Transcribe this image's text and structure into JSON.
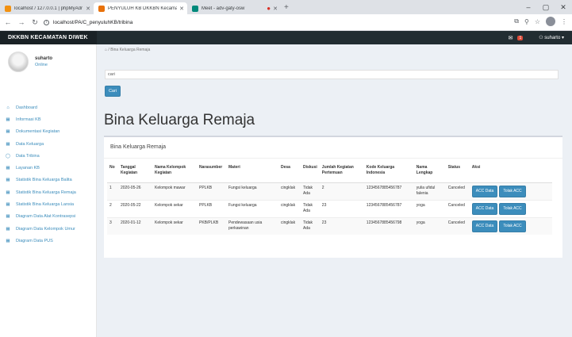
{
  "browser": {
    "tabs": [
      {
        "title": "localhost / 127.0.0.1 | phpMyAdr",
        "active": false,
        "favicon_color": "#f29111",
        "closable": true
      },
      {
        "title": "PENYULUH KB DKKBN Kecamatan",
        "active": true,
        "favicon_color": "#e8710a",
        "closable": true
      },
      {
        "title": "Meet - adv-gaty-osw",
        "active": false,
        "favicon_color": "#00897b",
        "recording": true,
        "closable": true
      }
    ],
    "new_tab": "+",
    "url": "localhost/PA/C_penyuluhKB/tribina",
    "window_controls": [
      "–",
      "▢",
      "✕"
    ]
  },
  "header": {
    "brand": "DKKBN KECAMATAN DIWEK",
    "mail_badge": "1",
    "user": "suharto"
  },
  "sidebar": {
    "user_name": "suharto",
    "user_status": "Online",
    "menu": [
      {
        "label": "Dashboard",
        "icon": "home-icon"
      },
      {
        "label": "Informasi KB",
        "icon": "table-icon"
      },
      {
        "label": "Dokumentasi Kegiatan",
        "icon": "table-icon"
      },
      {
        "label": "Data Keluarga",
        "icon": "table-icon"
      },
      {
        "label": "Data Tribina",
        "icon": "circle-icon"
      },
      {
        "label": "Layanan KB",
        "icon": "table-icon"
      },
      {
        "label": "Statistik Bina Keluarga Balita",
        "icon": "table-icon"
      },
      {
        "label": "Statistik Bina Keluarga Remaja",
        "icon": "table-icon"
      },
      {
        "label": "Statistik Bina Keluarga Lansia",
        "icon": "table-icon"
      },
      {
        "label": "Diagram Data Alat Kontrasepsi",
        "icon": "table-icon"
      },
      {
        "label": "Diagram Data Kelompok Umur",
        "icon": "table-icon"
      },
      {
        "label": "Diagram Data PUS",
        "icon": "table-icon"
      }
    ]
  },
  "main": {
    "breadcrumb": "Bina Keluarga Remaja",
    "search_placeholder": "cari",
    "search_button": "Cari",
    "page_title": "Bina Keluarga Remaja",
    "box_title": "Bina Keluarga Remaja",
    "table": {
      "headers": [
        "No",
        "Tanggal Kegiatan",
        "Nama Kelompok Kegiatan",
        "Narasumber",
        "Materi",
        "Desa",
        "Diskusi",
        "Jumlah Kegiatan Pertemuan",
        "Kode Keluarga Indonesia",
        "Nama Lengkap",
        "Status",
        "Aksi"
      ],
      "rows": [
        {
          "no": "1",
          "tanggal": "2020-05-26",
          "kelompok": "Kelompok mawar",
          "narasumber": "PPLKB",
          "materi": "Fungsi keluarga",
          "desa": "cingklak",
          "diskusi": "Tidak Ada",
          "jumlah": "2",
          "kki": "1234567885456787",
          "nama": "yulia ufidul falenia",
          "status": "Canceled",
          "acc": "ACC Data",
          "tolak": "Tolak ACC"
        },
        {
          "no": "2",
          "tanggal": "2020-05-22",
          "kelompok": "Kelompok sekar",
          "narasumber": "PPLKB",
          "materi": "Fungsi keluarga",
          "desa": "cingklak",
          "diskusi": "Tidak Ada",
          "jumlah": "23",
          "kki": "1234567885456787",
          "nama": "yoga",
          "status": "Canceled",
          "acc": "ACC Data",
          "tolak": "Tolak ACC"
        },
        {
          "no": "3",
          "tanggal": "2020-01-12",
          "kelompok": "Kelompok sekar",
          "narasumber": "PKB/PLKB",
          "materi": "Pendewasaan usia perkawinan",
          "desa": "cingklak",
          "diskusi": "Tidak Ada",
          "jumlah": "23",
          "kki": "1234567885456798",
          "nama": "yoga",
          "status": "Canceled",
          "acc": "ACC Data",
          "tolak": "Tolak ACC"
        }
      ]
    }
  },
  "colors": {
    "primary": "#3c8dbc",
    "header_dark": "#222d32",
    "danger": "#dd4b39"
  }
}
